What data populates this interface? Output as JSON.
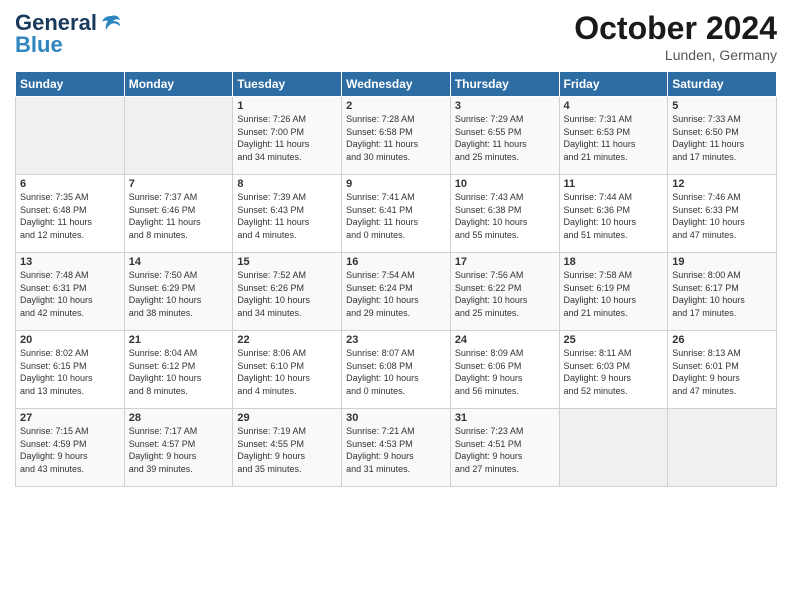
{
  "logo": {
    "line1": "General",
    "line2": "Blue"
  },
  "title": "October 2024",
  "location": "Lunden, Germany",
  "days_of_week": [
    "Sunday",
    "Monday",
    "Tuesday",
    "Wednesday",
    "Thursday",
    "Friday",
    "Saturday"
  ],
  "weeks": [
    [
      {
        "day": "",
        "info": ""
      },
      {
        "day": "",
        "info": ""
      },
      {
        "day": "1",
        "info": "Sunrise: 7:26 AM\nSunset: 7:00 PM\nDaylight: 11 hours\nand 34 minutes."
      },
      {
        "day": "2",
        "info": "Sunrise: 7:28 AM\nSunset: 6:58 PM\nDaylight: 11 hours\nand 30 minutes."
      },
      {
        "day": "3",
        "info": "Sunrise: 7:29 AM\nSunset: 6:55 PM\nDaylight: 11 hours\nand 25 minutes."
      },
      {
        "day": "4",
        "info": "Sunrise: 7:31 AM\nSunset: 6:53 PM\nDaylight: 11 hours\nand 21 minutes."
      },
      {
        "day": "5",
        "info": "Sunrise: 7:33 AM\nSunset: 6:50 PM\nDaylight: 11 hours\nand 17 minutes."
      }
    ],
    [
      {
        "day": "6",
        "info": "Sunrise: 7:35 AM\nSunset: 6:48 PM\nDaylight: 11 hours\nand 12 minutes."
      },
      {
        "day": "7",
        "info": "Sunrise: 7:37 AM\nSunset: 6:46 PM\nDaylight: 11 hours\nand 8 minutes."
      },
      {
        "day": "8",
        "info": "Sunrise: 7:39 AM\nSunset: 6:43 PM\nDaylight: 11 hours\nand 4 minutes."
      },
      {
        "day": "9",
        "info": "Sunrise: 7:41 AM\nSunset: 6:41 PM\nDaylight: 11 hours\nand 0 minutes."
      },
      {
        "day": "10",
        "info": "Sunrise: 7:43 AM\nSunset: 6:38 PM\nDaylight: 10 hours\nand 55 minutes."
      },
      {
        "day": "11",
        "info": "Sunrise: 7:44 AM\nSunset: 6:36 PM\nDaylight: 10 hours\nand 51 minutes."
      },
      {
        "day": "12",
        "info": "Sunrise: 7:46 AM\nSunset: 6:33 PM\nDaylight: 10 hours\nand 47 minutes."
      }
    ],
    [
      {
        "day": "13",
        "info": "Sunrise: 7:48 AM\nSunset: 6:31 PM\nDaylight: 10 hours\nand 42 minutes."
      },
      {
        "day": "14",
        "info": "Sunrise: 7:50 AM\nSunset: 6:29 PM\nDaylight: 10 hours\nand 38 minutes."
      },
      {
        "day": "15",
        "info": "Sunrise: 7:52 AM\nSunset: 6:26 PM\nDaylight: 10 hours\nand 34 minutes."
      },
      {
        "day": "16",
        "info": "Sunrise: 7:54 AM\nSunset: 6:24 PM\nDaylight: 10 hours\nand 29 minutes."
      },
      {
        "day": "17",
        "info": "Sunrise: 7:56 AM\nSunset: 6:22 PM\nDaylight: 10 hours\nand 25 minutes."
      },
      {
        "day": "18",
        "info": "Sunrise: 7:58 AM\nSunset: 6:19 PM\nDaylight: 10 hours\nand 21 minutes."
      },
      {
        "day": "19",
        "info": "Sunrise: 8:00 AM\nSunset: 6:17 PM\nDaylight: 10 hours\nand 17 minutes."
      }
    ],
    [
      {
        "day": "20",
        "info": "Sunrise: 8:02 AM\nSunset: 6:15 PM\nDaylight: 10 hours\nand 13 minutes."
      },
      {
        "day": "21",
        "info": "Sunrise: 8:04 AM\nSunset: 6:12 PM\nDaylight: 10 hours\nand 8 minutes."
      },
      {
        "day": "22",
        "info": "Sunrise: 8:06 AM\nSunset: 6:10 PM\nDaylight: 10 hours\nand 4 minutes."
      },
      {
        "day": "23",
        "info": "Sunrise: 8:07 AM\nSunset: 6:08 PM\nDaylight: 10 hours\nand 0 minutes."
      },
      {
        "day": "24",
        "info": "Sunrise: 8:09 AM\nSunset: 6:06 PM\nDaylight: 9 hours\nand 56 minutes."
      },
      {
        "day": "25",
        "info": "Sunrise: 8:11 AM\nSunset: 6:03 PM\nDaylight: 9 hours\nand 52 minutes."
      },
      {
        "day": "26",
        "info": "Sunrise: 8:13 AM\nSunset: 6:01 PM\nDaylight: 9 hours\nand 47 minutes."
      }
    ],
    [
      {
        "day": "27",
        "info": "Sunrise: 7:15 AM\nSunset: 4:59 PM\nDaylight: 9 hours\nand 43 minutes."
      },
      {
        "day": "28",
        "info": "Sunrise: 7:17 AM\nSunset: 4:57 PM\nDaylight: 9 hours\nand 39 minutes."
      },
      {
        "day": "29",
        "info": "Sunrise: 7:19 AM\nSunset: 4:55 PM\nDaylight: 9 hours\nand 35 minutes."
      },
      {
        "day": "30",
        "info": "Sunrise: 7:21 AM\nSunset: 4:53 PM\nDaylight: 9 hours\nand 31 minutes."
      },
      {
        "day": "31",
        "info": "Sunrise: 7:23 AM\nSunset: 4:51 PM\nDaylight: 9 hours\nand 27 minutes."
      },
      {
        "day": "",
        "info": ""
      },
      {
        "day": "",
        "info": ""
      }
    ]
  ]
}
